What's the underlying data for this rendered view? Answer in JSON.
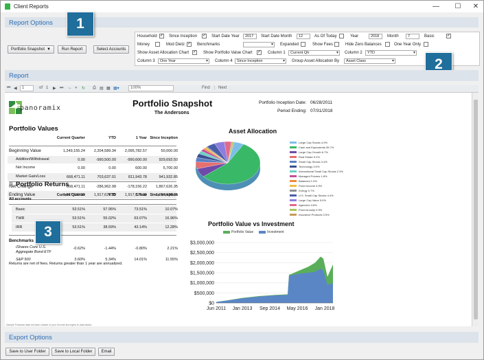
{
  "window": {
    "title": "Client Reports",
    "minimize": "—",
    "maximize": "☐",
    "close": "✕"
  },
  "report_options": {
    "title": "Report Options",
    "report_type": "Portfolio Snapshot",
    "run_report": "Run Report",
    "select_accounts": "Select Accounts",
    "household_label": "Household",
    "since_inception_label": "Since Inception",
    "start_date_year_label": "Start Date Year",
    "start_date_year": "2017",
    "start_date_month_label": "Start Date Month",
    "start_date_month": "12",
    "as_of_today_label": "As Of Today",
    "year_label": "Year",
    "year": "2018",
    "month_label": "Month",
    "month": "7",
    "basic_label": "Basic",
    "money_label": "Money",
    "mod_dietz_label": "Mod Dietz",
    "benchmarks_label": "Benchmarks",
    "expanded_label": "Expanded",
    "show_fees_label": "Show Fees",
    "hide_zero_balances_label": "Hide Zero Balances",
    "one_year_only_label": "One Year Only",
    "show_asset_allocation_chart_label": "Show Asset Allocation Chart",
    "show_portfolio_value_chart_label": "Show Portfolio Value Chart",
    "column1_label": "Column 1",
    "column1": "Current Qtr",
    "column2_label": "Column 2",
    "column2": "YTD",
    "column3_label": "Column 3",
    "column3": "One Year",
    "column4_label": "Column 4",
    "column4": "Since Inception",
    "group_by_label": "Group Asset Allocation By",
    "group_by": "Asset Class",
    "check": "✓"
  },
  "callouts": {
    "one": "1",
    "two": "2",
    "three": "3"
  },
  "report_section": {
    "title": "Report"
  },
  "viewer_toolbar": {
    "first": "⏮",
    "prev": "◀",
    "page": "1",
    "of_label": "of",
    "page_count": "1",
    "next": "▶",
    "last": "⏭",
    "zoom": "100%",
    "find": "Find",
    "next_label": "Next"
  },
  "logo": {
    "text": "panoramix"
  },
  "snapshot": {
    "title": "Portfolio Snapshot",
    "client": "The Andersons",
    "inception_label": "Portfolio Inception Date:",
    "inception_date": "06/28/2011",
    "period_label": "Period Ending:",
    "period_end": "07/31/2018"
  },
  "portfolio_values": {
    "title": "Portfolio Values",
    "headers": [
      "Current Quarter",
      "YTD",
      "1 Year",
      "Since Inception"
    ],
    "rows": [
      {
        "label": "Beginning Value",
        "values": [
          "1,249,155.24",
          "2,204,589.34",
          "2,095,782.57",
          "50,000.00"
        ]
      },
      {
        "label": "Addition/Withdrawal",
        "values": [
          "0.00",
          "-990,500.00",
          "-990,600.00",
          "929,693.50"
        ]
      },
      {
        "label": "Net Income",
        "values": [
          "0.00",
          "0.00",
          "600.00",
          "5,700.00"
        ]
      },
      {
        "label": "Market Gain/Loss",
        "values": [
          "668,471.11",
          "703,637.01",
          "811,943.78",
          "941,932.85"
        ]
      },
      {
        "label": "Net Change",
        "values": [
          "668,471.11",
          "-286,962.98",
          "-178,156.22",
          "1,867,626.35"
        ]
      },
      {
        "label": "Ending Value",
        "values": [
          "1,917,626.35",
          "1,917,626.35",
          "1,917,626.35",
          "1,917,626.35"
        ]
      }
    ]
  },
  "portfolio_returns": {
    "expand": "⊞",
    "title": "Portfolio Returns",
    "accounts_label": "All accounts",
    "headers": [
      "Current Quarter",
      "YTD",
      "1 Year",
      "Since Inception"
    ],
    "rows": [
      {
        "label": "Basic",
        "values": [
          "53.51%",
          "57.95%",
          "73.51%",
          "10.07%"
        ]
      },
      {
        "label": "TWR",
        "values": [
          "53.51%",
          "55.02%",
          "63.07%",
          "16.96%"
        ]
      },
      {
        "label": "IRR",
        "values": [
          "53.51%",
          "38.59%",
          "43.14%",
          "12.28%"
        ]
      }
    ],
    "benchmarks_label": "Benchmarks",
    "benchmarks": [
      {
        "label": "iShares Core U.S. Aggregate Bond ETF",
        "values": [
          "-0.62%",
          "-1.44%",
          "-0.80%",
          "2.21%"
        ]
      },
      {
        "label": "S&P 500",
        "values": [
          "3.60%",
          "5.34%",
          "14.01%",
          "11.55%"
        ]
      }
    ],
    "note": "Returns are net of fees. Returns greater than 1 year are annualized."
  },
  "disclaimer": "Sample Financial data not base outside of your records and rights to data based.",
  "export_options": {
    "title": "Export Options",
    "save_user_folder": "Save to User Folder",
    "save_local_folder": "Save to Local Folder",
    "email": "Email"
  },
  "chart_data": [
    {
      "type": "pie",
      "title": "Asset Allocation",
      "slices": [
        {
          "label": "Large Cap Stocks",
          "percent": 4.9,
          "color": "#7bbfe8"
        },
        {
          "label": "Cash and Equivalents",
          "percent": 55.7,
          "color": "#39b867"
        },
        {
          "label": "Large Cap Growth",
          "percent": 6.7,
          "color": "#6f4aa8"
        },
        {
          "label": "Real Estate",
          "percent": 5.2,
          "color": "#e66f6f"
        },
        {
          "label": "Small Cap Stocks",
          "percent": 3.4,
          "color": "#5a7fc4"
        },
        {
          "label": "Technology",
          "percent": 3.0,
          "color": "#3a4f8f"
        },
        {
          "label": "International Small Cap Stocks",
          "percent": 2.3,
          "color": "#6ad0c6"
        },
        {
          "label": "Managed Futures",
          "percent": 1.8,
          "color": "#c34e9a"
        },
        {
          "label": "Balanced",
          "percent": 1.0,
          "color": "#f08a3c"
        },
        {
          "label": "Fixed Income",
          "percent": 0.9,
          "color": "#ecbe43"
        },
        {
          "label": "Energy",
          "percent": 0.7,
          "color": "#8e8e8e"
        },
        {
          "label": "U.S. Small Cap Stocks",
          "percent": 4.4,
          "color": "#4a5ea8"
        },
        {
          "label": "Large Cap Value",
          "percent": 5.0,
          "color": "#8c7ee0"
        },
        {
          "label": "Agencies",
          "percent": 3.6,
          "color": "#e06a8c"
        },
        {
          "label": "Fixed Annuity",
          "percent": 0.9,
          "color": "#a9c75a"
        },
        {
          "label": "Insurance Products",
          "percent": 0.5,
          "color": "#c79a5a"
        }
      ]
    },
    {
      "type": "area",
      "title": "Portfolio Value vs Investment",
      "series": [
        {
          "name": "Portfolio Value",
          "color": "#5aae5a",
          "points": [
            [
              "2011-06",
              50000
            ],
            [
              "2012-01",
              120000
            ],
            [
              "2013-01",
              250000
            ],
            [
              "2014-01",
              340000
            ],
            [
              "2015-01",
              400000
            ],
            [
              "2015-10",
              430000
            ],
            [
              "2015-11",
              1400000
            ],
            [
              "2016-01",
              1450000
            ],
            [
              "2016-06",
              1600000
            ],
            [
              "2017-01",
              1800000
            ],
            [
              "2017-06",
              2000000
            ],
            [
              "2017-10",
              2300000
            ],
            [
              "2017-12",
              2200000
            ],
            [
              "2018-03",
              1300000
            ],
            [
              "2018-07",
              1917626
            ]
          ]
        },
        {
          "name": "Investment",
          "color": "#5b86c6",
          "points": [
            [
              "2011-06",
              50000
            ],
            [
              "2012-01",
              110000
            ],
            [
              "2013-01",
              230000
            ],
            [
              "2014-01",
              320000
            ],
            [
              "2015-01",
              380000
            ],
            [
              "2015-10",
              400000
            ],
            [
              "2015-11",
              1350000
            ],
            [
              "2016-01",
              1380000
            ],
            [
              "2016-06",
              1450000
            ],
            [
              "2017-01",
              1500000
            ],
            [
              "2017-06",
              1550000
            ],
            [
              "2017-10",
              1700000
            ],
            [
              "2017-12",
              1600000
            ],
            [
              "2018-03",
              900000
            ],
            [
              "2018-07",
              980000
            ]
          ]
        }
      ],
      "x_ticks": [
        "Jun 2011",
        "Jan 2013",
        "Sep 2014",
        "May 2016",
        "Jan 2018"
      ],
      "y_ticks": [
        "$0",
        "$500,000",
        "$1,000,000",
        "$1,500,000",
        "$2,000,000",
        "$2,500,000",
        "$3,000,000"
      ],
      "ylim": [
        0,
        3000000
      ]
    }
  ]
}
